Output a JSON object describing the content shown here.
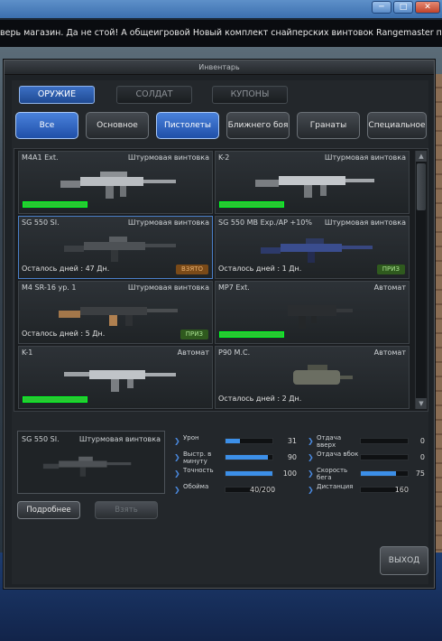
{
  "marquee_text": "верь магазин. Да не стой! А общеигровой  Новый комплект снайперских винтовок Rangemaster позволит оі",
  "window_title": "Инвентарь",
  "tabs": [
    {
      "label": "ОРУЖИЕ",
      "active": true
    },
    {
      "label": "СОЛДАТ",
      "active": false
    },
    {
      "label": "КУПОНЫ",
      "active": false
    }
  ],
  "filters": [
    {
      "label": "Все",
      "active": true
    },
    {
      "label": "Основное",
      "active": false
    },
    {
      "label": "Пистолеты",
      "active": true
    },
    {
      "label": "Ближнего боя",
      "active": false
    },
    {
      "label": "Гранаты",
      "active": false
    },
    {
      "label": "Специальное",
      "active": false
    }
  ],
  "items": [
    {
      "name": "M4A1 Ext.",
      "type": "Штурмовая винтовка",
      "days": "",
      "bar": 1.0,
      "badge": ""
    },
    {
      "name": "K-2",
      "type": "Штурмовая винтовка",
      "days": "",
      "bar": 1.0,
      "badge": ""
    },
    {
      "name": "SG 550 SI.",
      "type": "Штурмовая винтовка",
      "days": "Осталось дней : 47 Дн.",
      "bar": null,
      "badge": "ВЗЯТО"
    },
    {
      "name": "SG 550 MB Exp./AP +10%",
      "type": "Штурмовая винтовка",
      "days": "Осталось дней : 1 Дн.",
      "bar": null,
      "badge": "ПРИЗ"
    },
    {
      "name": "M4 SR-16 ур. 1",
      "type": "Штурмовая винтовка",
      "days": "Осталось дней : 5 Дн.",
      "bar": null,
      "badge": "ПРИЗ"
    },
    {
      "name": "MP7 Ext.",
      "type": "Автомат",
      "days": "",
      "bar": 1.0,
      "badge": ""
    },
    {
      "name": "K-1",
      "type": "Автомат",
      "days": "",
      "bar": 1.0,
      "badge": ""
    },
    {
      "name": "P90 M.C.",
      "type": "Автомат",
      "days": "Осталось дней : 2 Дн.",
      "bar": null,
      "badge": ""
    }
  ],
  "detail": {
    "name": "SG 550 SI.",
    "type": "Штурмовая винтовка",
    "details_button": "Подробнее",
    "take_button": "Взять"
  },
  "stats_left": [
    {
      "label": "Урон",
      "value": "31",
      "fill": 0.31
    },
    {
      "label": "Выстр. в минуту",
      "value": "90",
      "fill": 0.9
    },
    {
      "label": "Точность",
      "value": "100",
      "fill": 1.0
    },
    {
      "label": "Обойма",
      "value": "40/200",
      "fill": null
    }
  ],
  "stats_right": [
    {
      "label": "Отдача вверх",
      "value": "0",
      "fill": 0
    },
    {
      "label": "Отдача вбок",
      "value": "0",
      "fill": 0
    },
    {
      "label": "Скорость бега",
      "value": "75",
      "fill": 0.75
    },
    {
      "label": "Дистанция",
      "value": "160",
      "fill": null
    }
  ],
  "exit_label": "ВЫХОД",
  "colors": {
    "accent_blue": "#3c6fc4",
    "prize_green": "#2f5a1e",
    "taken_orange": "#7a4a18",
    "bar_green": "#28c832"
  }
}
